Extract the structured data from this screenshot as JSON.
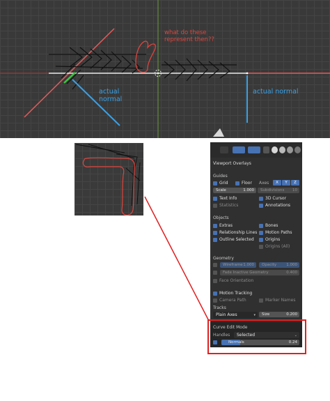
{
  "annotations": {
    "question_line1": "what do these",
    "question_line2": "represent then??",
    "actual_normal_left_line1": "actual",
    "actual_normal_left_line2": "normal",
    "actual_normal_right": "actual normal"
  },
  "colors": {
    "annotation_red": "#e0443c",
    "annotation_blue": "#3aa0e4",
    "annotation_green": "#3cc43c",
    "curve_line": "#e85a5a",
    "highlight_box": "#e02020",
    "accent": "#4772b3"
  },
  "toolbar": {
    "icons": [
      "overlay-toggle-icon",
      "gizmo-icon",
      "overlays-dropdown-icon",
      "xray-icon",
      "wireframe-shading-icon",
      "solid-shading-icon",
      "material-preview-icon",
      "rendered-shading-icon"
    ]
  },
  "panel": {
    "title": "Viewport Overlays",
    "guides": {
      "heading": "Guides",
      "grid": "Grid",
      "floor": "Floor",
      "axes": "Axes",
      "x": "X",
      "y": "Y",
      "z": "Z",
      "scale_label": "Scale",
      "scale_value": "1.000",
      "subdivisions_label": "Subdivisions",
      "subdivisions_value": "10",
      "text_info": "Text Info",
      "cursor_3d": "3D Cursor",
      "statistics": "Statistics",
      "annotations": "Annotations"
    },
    "objects": {
      "heading": "Objects",
      "extras": "Extras",
      "bones": "Bones",
      "relationship_lines": "Relationship Lines",
      "motion_paths": "Motion Paths",
      "outline_selected": "Outline Selected",
      "origins": "Origins",
      "origins_all": "Origins (All)"
    },
    "geometry": {
      "heading": "Geometry",
      "wireframe_label": "Wireframe",
      "wireframe_value": "1.000",
      "opacity_label": "Opacity",
      "opacity_value": "1.000",
      "fade_label": "Fade Inactive Geometry",
      "fade_value": "0.400",
      "face_orientation": "Face Orientation"
    },
    "motion_tracking": {
      "label": "Motion Tracking",
      "camera_path": "Camera Path",
      "marker_names": "Marker Names",
      "tracks_heading": "Tracks",
      "tracks_value": "Plain Axes",
      "size_label": "Size",
      "size_value": "0.200"
    },
    "curve_edit": {
      "heading": "Curve Edit Mode",
      "handles_label": "Handles",
      "handles_value": "Selected",
      "normals_label": "Normals",
      "normals_value": "0.24",
      "normals_fill": 0.24
    }
  }
}
